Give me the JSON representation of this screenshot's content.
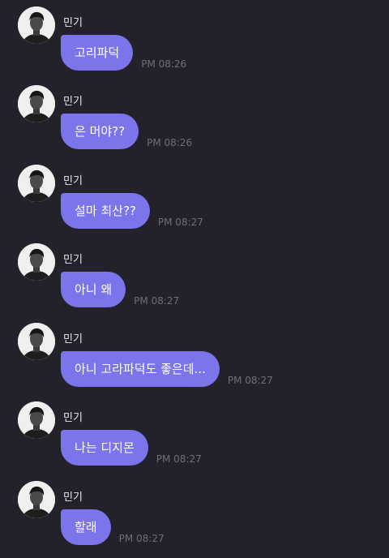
{
  "messages": [
    {
      "sender": "민기",
      "text": "고리파덕",
      "time": "PM 08:26"
    },
    {
      "sender": "민기",
      "text": "은 머야??",
      "time": "PM 08:26"
    },
    {
      "sender": "민기",
      "text": "설마 최산??",
      "time": "PM 08:27"
    },
    {
      "sender": "민기",
      "text": "아니 왜",
      "time": "PM 08:27"
    },
    {
      "sender": "민기",
      "text": "아니 고라파덕도 좋은데...",
      "time": "PM 08:27"
    },
    {
      "sender": "민기",
      "text": "나는 디지몬",
      "time": "PM 08:27"
    },
    {
      "sender": "민기",
      "text": "할래",
      "time": "PM 08:27"
    }
  ],
  "colors": {
    "background": "#23222b",
    "bubble": "#7b74ea",
    "bubble_text": "#ffffff",
    "timestamp": "#6f6e78",
    "sender_name": "#e6e6ea"
  },
  "icons": {
    "avatar": "profile-photo-avatar"
  }
}
